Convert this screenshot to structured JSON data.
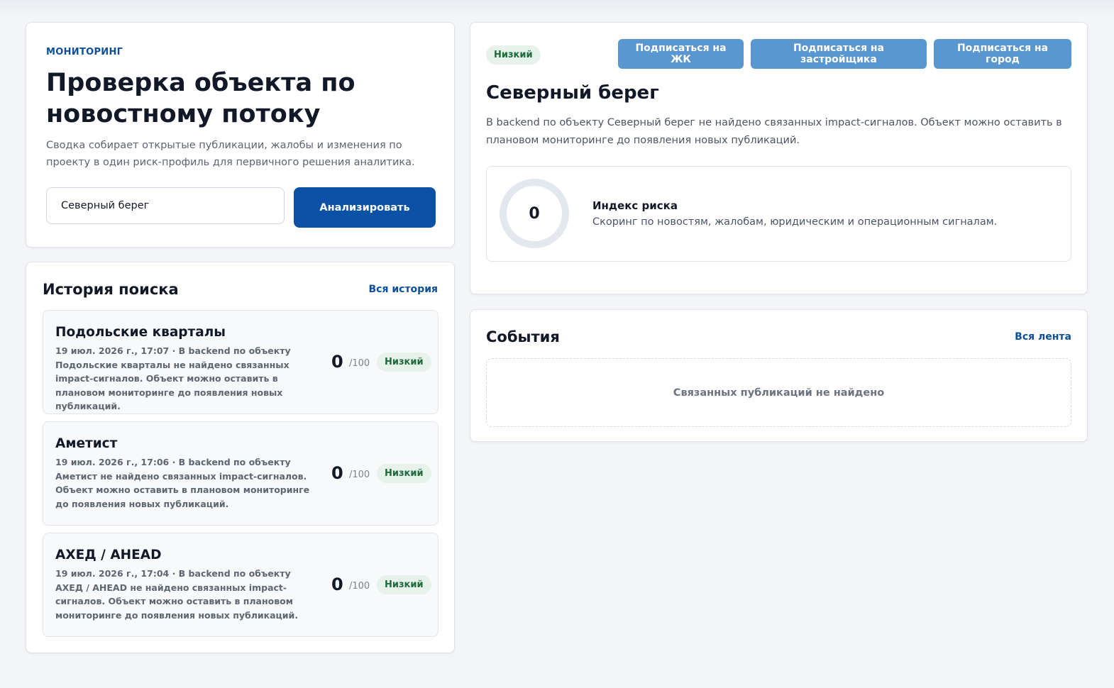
{
  "search": {
    "eyebrow": "МОНИТОРИНГ",
    "title": "Проверка объекта по новостному потоку",
    "description": "Сводка собирает открытые публикации, жалобы и изменения по проекту в один риск-профиль для первичного решения аналитика.",
    "input_value": "Северный берег",
    "analyze_label": "Анализировать"
  },
  "history": {
    "title": "История поиска",
    "all_link": "Вся история",
    "scale": "/100",
    "items": [
      {
        "name": "Подольские кварталы",
        "meta": "19 июл. 2026 г., 17:07 · В backend по объекту Подольские кварталы не найдено связанных impact-сигналов. Объект можно оставить в плановом мониторинге до появления новых публикаций.",
        "score": "0",
        "badge": "Низкий"
      },
      {
        "name": "Аметист",
        "meta": "19 июл. 2026 г., 17:06 · В backend по объекту Аметист не найдено связанных impact-сигналов. Объект можно оставить в плановом мониторинге до появления новых публикаций.",
        "score": "0",
        "badge": "Низкий"
      },
      {
        "name": "АХЕД / AHEAD",
        "meta": "19 июл. 2026 г., 17:04 · В backend по объекту АХЕД / AHEAD не найдено связанных impact-сигналов. Объект можно оставить в плановом мониторинге до появления новых публикаций.",
        "score": "0",
        "badge": "Низкий"
      }
    ]
  },
  "object": {
    "badge": "Низкий",
    "subscribe_complex": "Подписаться на ЖК",
    "subscribe_developer": "Подписаться на застройщика",
    "subscribe_city": "Подписаться на город",
    "title": "Северный берег",
    "description": "В backend по объекту Северный берег не найдено связанных impact-сигналов. Объект можно оставить в плановом мониторинге до появления новых публикаций.",
    "risk_value": "0",
    "risk_label": "Индекс риска",
    "risk_sub": "Скоринг по новостям, жалобам, юридическим и операционным сигналам."
  },
  "events": {
    "title": "События",
    "all_link": "Вся лента",
    "empty": "Связанных публикаций не найдено"
  },
  "colors": {
    "accent": "#0b52a6",
    "accent_light": "#5a96cf",
    "badge_bg": "#e6f2ea",
    "badge_text": "#1d6a3a"
  }
}
